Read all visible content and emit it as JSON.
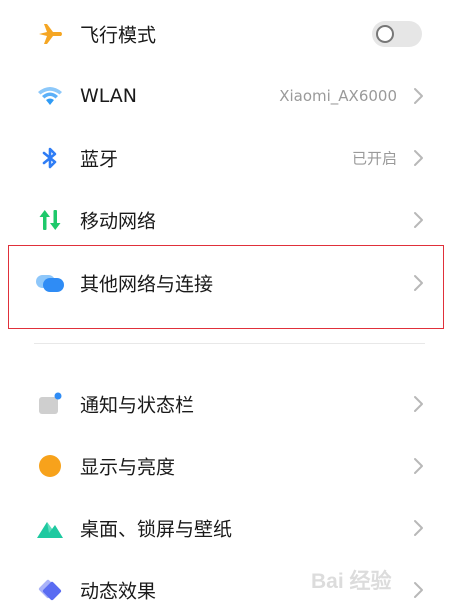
{
  "settings": {
    "airplane": {
      "label": "飞行模式",
      "enabled": false
    },
    "wlan": {
      "label": "WLAN",
      "value": "Xiaomi_AX6000"
    },
    "bluetooth": {
      "label": "蓝牙",
      "value": "已开启"
    },
    "mobile": {
      "label": "移动网络"
    },
    "other": {
      "label": "其他网络与连接"
    },
    "notification": {
      "label": "通知与状态栏"
    },
    "display": {
      "label": "显示与亮度"
    },
    "desktop": {
      "label": "桌面、锁屏与壁纸"
    },
    "effects": {
      "label": "动态效果"
    }
  },
  "icons": {
    "airplane": "airplane-icon",
    "wlan": "wifi-icon",
    "bluetooth": "bluetooth-icon",
    "mobile": "mobile-data-icon",
    "other": "cloud-link-icon",
    "notification": "notification-icon",
    "display": "brightness-icon",
    "desktop": "wallpaper-icon",
    "effects": "animation-icon"
  },
  "colors": {
    "highlight": "#e0303a",
    "airplane": "#f5a623",
    "wlan": "#2f9bf5",
    "bluetooth": "#2f7df5",
    "mobile": "#1ec96b",
    "other": "#2f8cf5",
    "display": "#f7a21b",
    "desktop": "#1ec9a0",
    "effects": "#5a6cf2"
  },
  "watermark": {
    "text": "Bai 经验"
  }
}
